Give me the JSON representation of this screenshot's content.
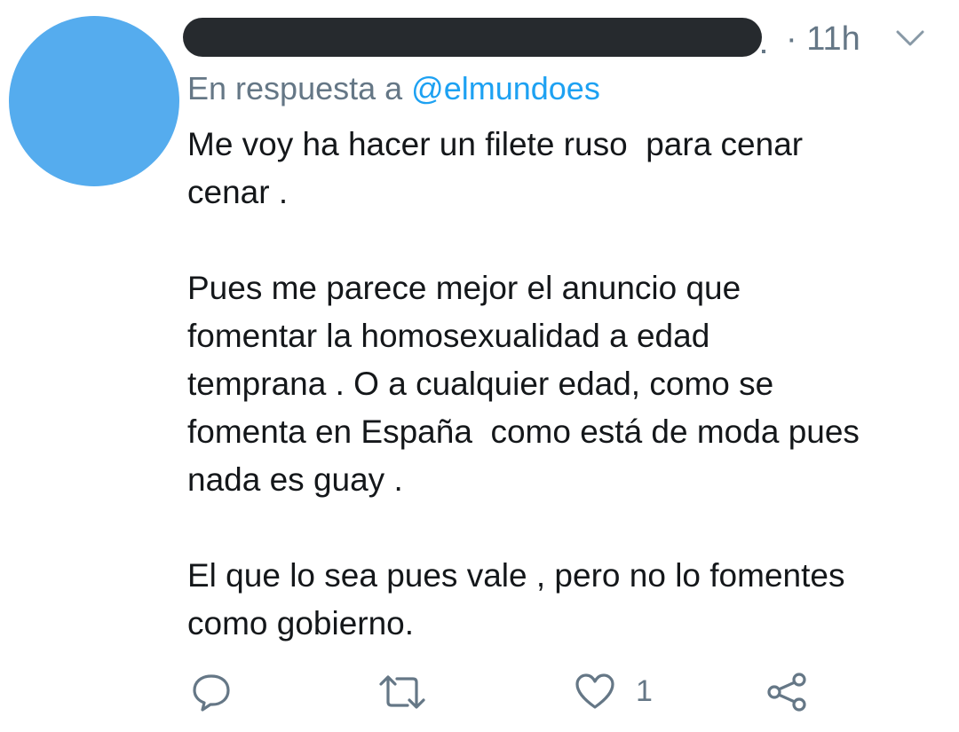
{
  "tweet": {
    "timestamp": "· 11h",
    "reply_prefix": "En respuesta a",
    "reply_handle": "@elmundoes",
    "paragraphs": [
      "Me voy ha hacer un filete ruso  para cenar\ncenar .",
      "Pues me parece mejor el anuncio que\nfomentar la homosexualidad a edad\ntemprana . O a cualquier edad, como se\nfomenta en España  como está de moda pues\nnada es guay .",
      "El que lo sea pues vale , pero no lo fomentes\ncomo gobierno."
    ],
    "likes": "1"
  },
  "icons": {
    "menu": "chevron-down-icon",
    "reply": "comment-bubble-icon",
    "retweet": "retweet-icon",
    "like": "heart-icon",
    "share": "share-icon"
  },
  "colors": {
    "avatar": "#55acee",
    "handle": "#1da1f2",
    "muted": "#657786",
    "text": "#14171a",
    "redaction": "#262a2e"
  }
}
